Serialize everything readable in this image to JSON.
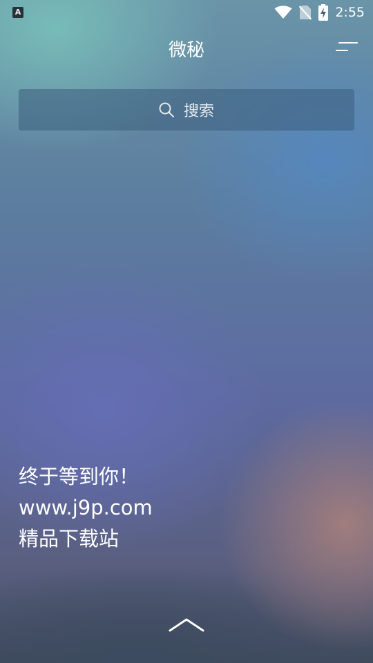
{
  "status_bar": {
    "notification_app_letter": "A",
    "time": "2:55",
    "icons": [
      "wifi-icon",
      "no-sim-icon",
      "battery-charging-icon"
    ]
  },
  "header": {
    "title": "微秘",
    "menu_icon": "menu-icon"
  },
  "search": {
    "icon": "search-icon",
    "placeholder": "搜索"
  },
  "promo": {
    "line1": "终于等到你！",
    "line2": "www.j9p.com",
    "line3": "精品下载站"
  },
  "footer": {
    "expand_icon": "chevron-up-icon"
  },
  "colors": {
    "text": "#ffffff",
    "search_background": "#3c5f7d"
  }
}
